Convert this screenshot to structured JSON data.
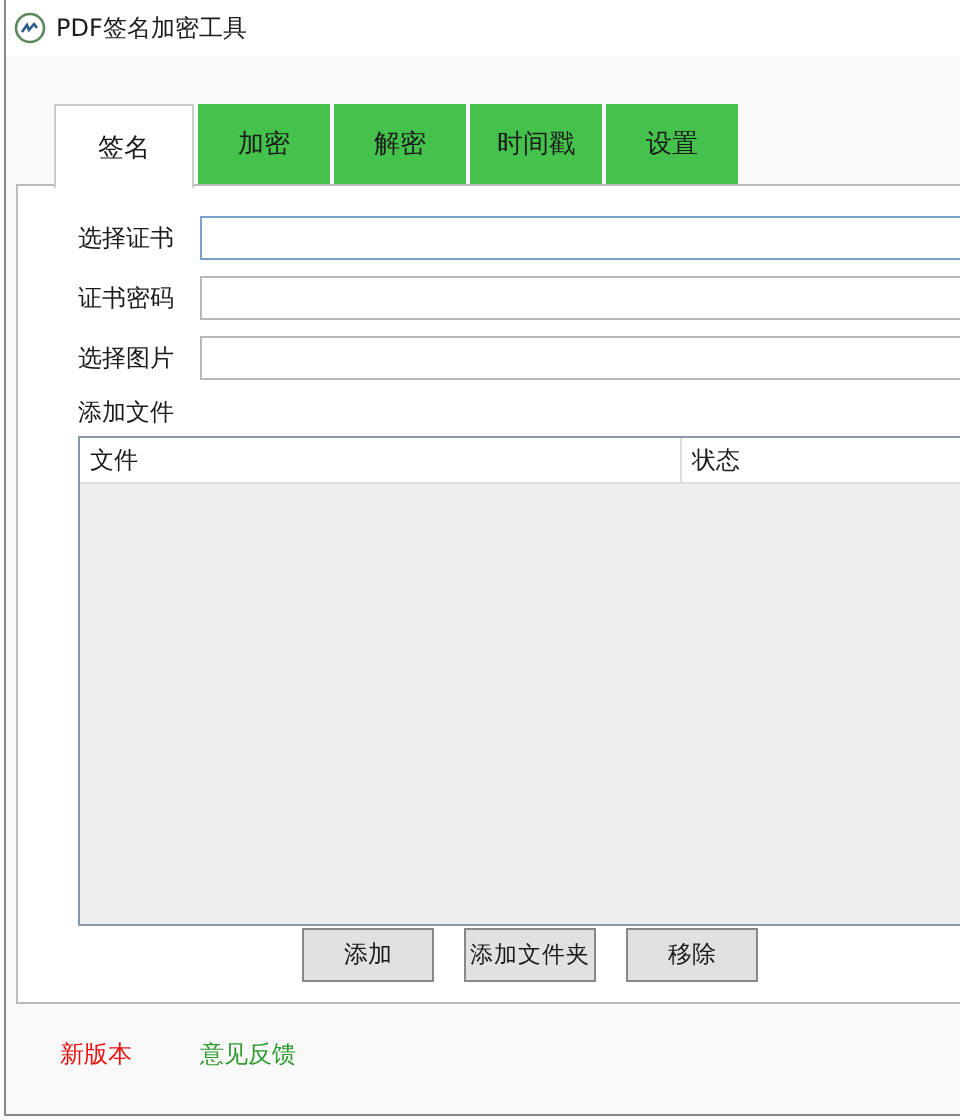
{
  "window": {
    "title": "PDF签名加密工具"
  },
  "tabs": [
    {
      "label": "签名",
      "selected": true
    },
    {
      "label": "加密",
      "selected": false
    },
    {
      "label": "解密",
      "selected": false
    },
    {
      "label": "时间戳",
      "selected": false
    },
    {
      "label": "设置",
      "selected": false
    }
  ],
  "fields": [
    {
      "label": "选择证书",
      "focused": true
    },
    {
      "label": "证书密码",
      "focused": false
    },
    {
      "label": "选择图片",
      "focused": false
    }
  ],
  "files": {
    "label": "添加文件",
    "columns": [
      "文件",
      "状态"
    ]
  },
  "buttons": [
    "添加",
    "添加文件夹",
    "移除"
  ],
  "links": [
    {
      "label": "新版本",
      "color": "#e81010"
    },
    {
      "label": "意见反馈",
      "color": "#2e9a2e"
    }
  ]
}
